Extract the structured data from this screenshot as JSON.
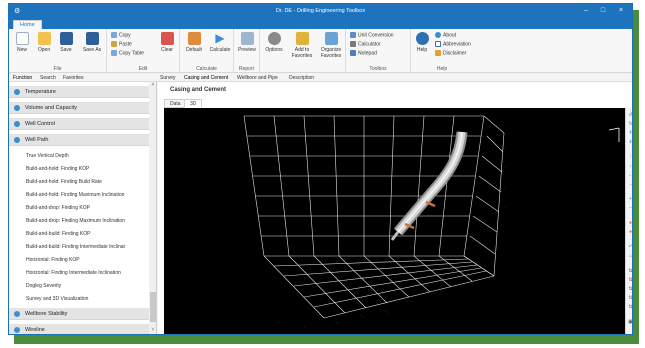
{
  "window": {
    "title": "Dr. DE - Drilling Engineering Toolbox",
    "minimize_glyph": "–",
    "maximize_glyph": "□",
    "close_glyph": "×",
    "app_icon": "app-logo-icon"
  },
  "ribbon": {
    "tab_label": "Home",
    "groups": {
      "file": "File",
      "edit": "Edit",
      "calculate": "Calculate",
      "report": "Report",
      "toolbox": "Toolbox",
      "help": "Help"
    },
    "buttons": {
      "new": "New",
      "open": "Open",
      "save": "Save",
      "save_as": "Save As",
      "copy": "Copy",
      "paste": "Paste",
      "copy_table": "Copy Table",
      "clear": "Clear",
      "default": "Default",
      "calculate": "Calculate",
      "preview": "Preview",
      "options": "Options",
      "add_to_favorites_1": "Add to",
      "add_to_favorites_2": "Favorites",
      "organize_favorites_1": "Organize",
      "organize_favorites_2": "Favorites",
      "unit_conversion": "Unit Conversion",
      "calculator": "Calculator",
      "notepad": "Notepad",
      "help": "Help",
      "about": "About",
      "abbreviation": "Abbreviation",
      "disclaimer": "Disclaimer"
    }
  },
  "toolbar2": {
    "function": "Function",
    "search": "Search",
    "favorites": "Favorites",
    "survey": "Survey",
    "casing_and_cement": "Casing and Cement",
    "wellbore_and_pipe": "Wellbore and Pipe",
    "description": "Description"
  },
  "sidebar": {
    "sections": {
      "temperature": "Temperature",
      "volume_capacity": "Volume and Capacity",
      "well_control": "Well Control",
      "well_path": "Well Path",
      "wellbore_stability": "Wellbore Stability",
      "wireline": "Wireline"
    },
    "well_path_items": [
      "True Vertical Depth",
      "Build-and-hold: Finding KOP",
      "Build-and-hold: Finding Build Rate",
      "Build-and-hold: Finding Maximum Inclination",
      "Build-and-drop: Finding KOP",
      "Build-and-drop: Finding Maximum Inclination",
      "Build-and-build: Finding KOP",
      "Build-and-build: Finding Intermediate Inclinat",
      "Horizontal: Finding KOP",
      "Horizontal: Finding Intermediate Inclination",
      "Dogleg Severity",
      "Survey and 3D Visualization"
    ],
    "scroll_up": "˄",
    "scroll_down": "˅"
  },
  "content": {
    "title": "Casing and Cement",
    "tabs": {
      "data": "Data",
      "view_3d": "3D"
    }
  },
  "colors": {
    "accent": "#1e73be",
    "frame_green": "#4a8c3a",
    "viewport_bg": "#000000"
  }
}
